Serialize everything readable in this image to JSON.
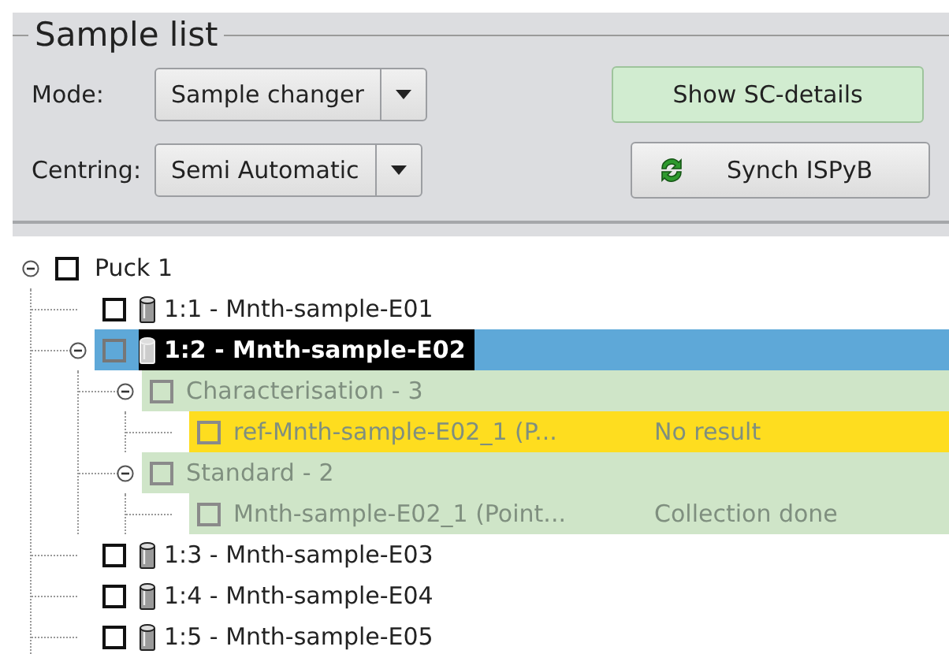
{
  "panel": {
    "title": "Sample list",
    "fields": [
      {
        "label": "Mode:",
        "value": "Sample changer"
      },
      {
        "label": "Centring:",
        "value": "Semi Automatic"
      }
    ],
    "buttons": [
      {
        "label": "Show SC-details",
        "kind": "highlighted"
      },
      {
        "label": "Synch ISPyB",
        "kind": "sync"
      }
    ]
  },
  "tree": [
    {
      "kind": "puck",
      "label": "Puck 1",
      "checked": false,
      "selected": false,
      "disabled": false,
      "expanded": true,
      "children": [
        {
          "kind": "sample",
          "label": "1:1 - Mnth-sample-E01",
          "checked": false,
          "selected": false,
          "disabled": false
        },
        {
          "kind": "sample",
          "label": "1:2 - Mnth-sample-E02",
          "checked": false,
          "selected": true,
          "disabled": false,
          "expanded": true,
          "children": [
            {
              "kind": "group",
              "label": "Characterisation - 3",
              "checked": false,
              "selected": false,
              "disabled": true,
              "expanded": true,
              "color": "#cfe5c8",
              "children": [
                {
                  "kind": "task",
                  "label": "ref-Mnth-sample-E02_1 (P...",
                  "status": "No result",
                  "checked": false,
                  "selected": false,
                  "disabled": true,
                  "color": "#fedd1f"
                }
              ]
            },
            {
              "kind": "group",
              "label": "Standard - 2",
              "checked": false,
              "selected": false,
              "disabled": true,
              "expanded": true,
              "color": "#cfe5c8",
              "children": [
                {
                  "kind": "task",
                  "label": "Mnth-sample-E02_1 (Point...",
                  "status": "Collection done",
                  "checked": false,
                  "selected": false,
                  "disabled": true,
                  "color": "#cfe5c8"
                }
              ]
            }
          ]
        },
        {
          "kind": "sample",
          "label": "1:3 - Mnth-sample-E03",
          "checked": false,
          "selected": false,
          "disabled": false
        },
        {
          "kind": "sample",
          "label": "1:4 - Mnth-sample-E04",
          "checked": false,
          "selected": false,
          "disabled": false
        },
        {
          "kind": "sample",
          "label": "1:5 - Mnth-sample-E05",
          "checked": false,
          "selected": false,
          "disabled": false
        }
      ]
    }
  ]
}
